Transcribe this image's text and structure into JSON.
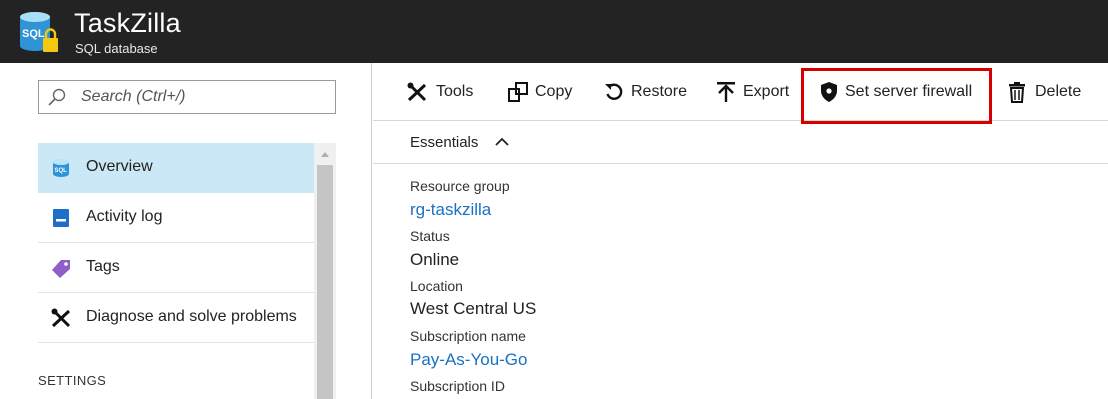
{
  "header": {
    "title": "TaskZilla",
    "subtitle": "SQL database",
    "icon": "sql-database-icon"
  },
  "search": {
    "placeholder": "Search (Ctrl+/)"
  },
  "sidebar": {
    "items": [
      {
        "label": "Overview",
        "icon": "sql-database-icon",
        "active": true
      },
      {
        "label": "Activity log",
        "icon": "activity-log-icon",
        "active": false
      },
      {
        "label": "Tags",
        "icon": "tag-icon",
        "active": false
      },
      {
        "label": "Diagnose and solve problems",
        "icon": "tools-icon",
        "active": false
      }
    ],
    "section_heading": "SETTINGS"
  },
  "toolbar": {
    "buttons": [
      {
        "label": "Tools",
        "icon": "tools-icon"
      },
      {
        "label": "Copy",
        "icon": "copy-icon"
      },
      {
        "label": "Restore",
        "icon": "restore-icon"
      },
      {
        "label": "Export",
        "icon": "export-icon"
      },
      {
        "label": "Set server firewall",
        "icon": "shield-icon",
        "highlighted": true
      },
      {
        "label": "Delete",
        "icon": "trash-icon"
      }
    ]
  },
  "essentials": {
    "label": "Essentials",
    "properties": [
      {
        "label": "Resource group",
        "value": "rg-taskzilla",
        "link": true
      },
      {
        "label": "Status",
        "value": "Online",
        "link": false
      },
      {
        "label": "Location",
        "value": "West Central US",
        "link": false
      },
      {
        "label": "Subscription name",
        "value": "Pay-As-You-Go",
        "link": true
      },
      {
        "label": "Subscription ID",
        "value": "",
        "link": false
      }
    ]
  },
  "colors": {
    "header_bg": "#232323",
    "active_nav_bg": "#cbe8f6",
    "link": "#1a71c1",
    "highlight_border": "#d60000"
  }
}
